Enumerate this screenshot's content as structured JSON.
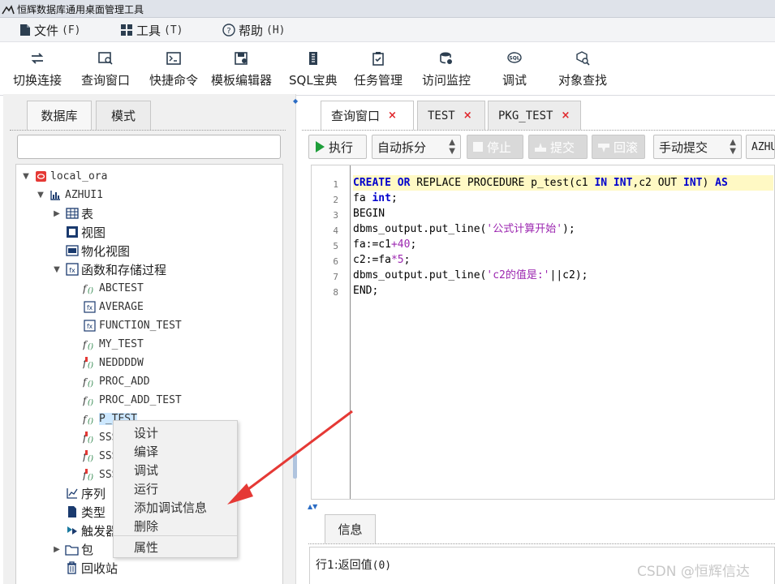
{
  "window": {
    "title": "恒辉数据库通用桌面管理工具"
  },
  "menubar": [
    {
      "label": "文件",
      "mnemonic": "(F)",
      "icon": "file-icon"
    },
    {
      "label": "工具",
      "mnemonic": "(T)",
      "icon": "tools-icon"
    },
    {
      "label": "帮助",
      "mnemonic": "(H)",
      "icon": "help-icon"
    }
  ],
  "toolbar": [
    {
      "label": "切换连接",
      "icon": "switch-connection-icon"
    },
    {
      "label": "查询窗口",
      "icon": "query-window-icon"
    },
    {
      "label": "快捷命令",
      "icon": "shortcut-command-icon"
    },
    {
      "label": "模板编辑器",
      "icon": "template-editor-icon"
    },
    {
      "label": "SQL宝典",
      "icon": "sql-book-icon"
    },
    {
      "label": "任务管理",
      "icon": "task-manager-icon"
    },
    {
      "label": "访问监控",
      "icon": "access-monitor-icon"
    },
    {
      "label": "调试",
      "icon": "debug-icon",
      "badge": "SQL"
    },
    {
      "label": "对象查找",
      "icon": "object-search-icon"
    }
  ],
  "left_tabs": [
    "数据库",
    "模式"
  ],
  "tree": {
    "connection": "local_ora",
    "schema": "AZHUI1",
    "folders": {
      "tables": "表",
      "views": "视图",
      "materialized_views": "物化视图",
      "functions_procedures": "函数和存储过程",
      "sequences": "序列",
      "types": "类型",
      "triggers": "触发器",
      "packages": "包",
      "recycle_bin": "回收站"
    },
    "routines": [
      {
        "name": "ABCTEST",
        "kind": "procedure"
      },
      {
        "name": "AVERAGE",
        "kind": "function"
      },
      {
        "name": "FUNCTION_TEST",
        "kind": "function"
      },
      {
        "name": "MY_TEST",
        "kind": "procedure"
      },
      {
        "name": "NEDDDDW",
        "kind": "procedure-invalid"
      },
      {
        "name": "PROC_ADD",
        "kind": "procedure"
      },
      {
        "name": "PROC_ADD_TEST",
        "kind": "procedure"
      },
      {
        "name": "P_TEST",
        "kind": "procedure",
        "selected": true
      },
      {
        "name": "SSS",
        "kind": "procedure-invalid"
      },
      {
        "name": "SSS",
        "kind": "procedure-invalid"
      },
      {
        "name": "SSS",
        "kind": "procedure-invalid"
      }
    ]
  },
  "context_menu": {
    "items": [
      "设计",
      "编译",
      "调试",
      "运行",
      "添加调试信息",
      "删除",
      "属性"
    ]
  },
  "editor_tabs": [
    {
      "label": "查询窗口",
      "active": true
    },
    {
      "label": "TEST",
      "active": false
    },
    {
      "label": "PKG_TEST",
      "active": false
    }
  ],
  "query_toolbar": {
    "execute": "执行",
    "split_mode": "自动拆分",
    "stop": "停止",
    "commit": "提交",
    "rollback": "回滚",
    "commit_mode": "手动提交",
    "connection": "AZHU"
  },
  "editor": {
    "line_numbers": [
      "1",
      "2",
      "3",
      "4",
      "5",
      "6",
      "7",
      "8"
    ],
    "lines": [
      [
        [
          "kw",
          "CREATE"
        ],
        [
          "plain",
          " "
        ],
        [
          "kw",
          "OR"
        ],
        [
          "plain",
          " REPLACE PROCEDURE p_test("
        ],
        [
          "plain",
          "c1 "
        ],
        [
          "kw",
          "IN"
        ],
        [
          "plain",
          " "
        ],
        [
          "kw",
          "INT"
        ],
        [
          "plain",
          ",c2 OUT "
        ],
        [
          "kw",
          "INT"
        ],
        [
          "plain",
          ") "
        ],
        [
          "kw",
          "AS"
        ]
      ],
      [
        [
          "plain",
          "fa "
        ],
        [
          "kw",
          "int"
        ],
        [
          "plain",
          ";"
        ]
      ],
      [
        [
          "plain",
          "BEGIN"
        ]
      ],
      [
        [
          "plain",
          "dbms_output.put_line("
        ],
        [
          "str",
          "'公式计算开始'"
        ],
        [
          "plain",
          ");"
        ]
      ],
      [
        [
          "plain",
          "fa:=c1"
        ],
        [
          "num",
          "+40"
        ],
        [
          "plain",
          ";"
        ]
      ],
      [
        [
          "plain",
          "c2:=fa"
        ],
        [
          "num",
          "*5"
        ],
        [
          "plain",
          ";"
        ]
      ],
      [
        [
          "plain",
          "dbms_output.put_line("
        ],
        [
          "str",
          "'c2的值是:'"
        ],
        [
          "plain",
          "||c2);"
        ]
      ],
      [
        [
          "plain",
          "END;"
        ]
      ]
    ]
  },
  "info_panel": {
    "tab": "信息",
    "message_prefix": "行1:返回值",
    "message_value": "(0)"
  },
  "watermark": "CSDN @恒辉信达",
  "colors": {
    "keyword": "#0000cc",
    "string": "#9c27b0",
    "highlight_line": "#fff9c4",
    "close_x": "#e0262b",
    "annotation_arrow": "#e53935",
    "selection": "#cde8ff"
  }
}
